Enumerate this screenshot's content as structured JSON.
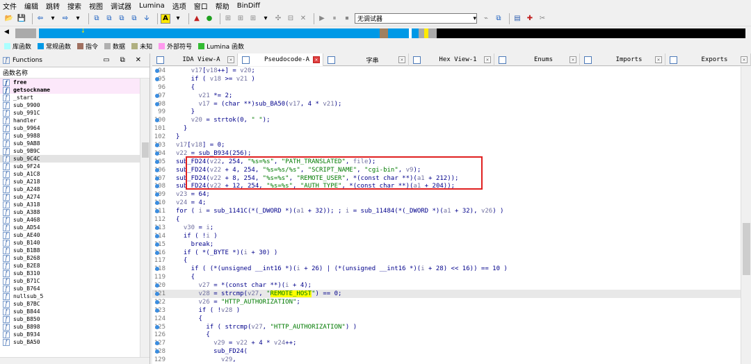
{
  "menu": [
    "文件",
    "编辑",
    "跳转",
    "搜索",
    "视图",
    "调试器",
    "Lumina",
    "选项",
    "窗口",
    "帮助",
    "BinDiff"
  ],
  "toolbar": {
    "debugger_select": "无调试器"
  },
  "legend": [
    {
      "label": "库函数",
      "color": "#aaffff"
    },
    {
      "label": "常规函数",
      "color": "#0099e6"
    },
    {
      "label": "指令",
      "color": "#a07060"
    },
    {
      "label": "数据",
      "color": "#b0b0b0"
    },
    {
      "label": "未知",
      "color": "#b0b080"
    },
    {
      "label": "外部符号",
      "color": "#ff99ee"
    },
    {
      "label": "Lumina 函数",
      "color": "#33bb33"
    }
  ],
  "functions": {
    "title": "Functions",
    "column_header": "函数名称",
    "items": [
      {
        "name": "free",
        "lib": true
      },
      {
        "name": "getsockname",
        "lib": true
      },
      {
        "name": "_start"
      },
      {
        "name": "sub_9900"
      },
      {
        "name": "sub_991C"
      },
      {
        "name": "handler"
      },
      {
        "name": "sub_9964"
      },
      {
        "name": "sub_9988"
      },
      {
        "name": "sub_9AB8"
      },
      {
        "name": "sub_9B9C"
      },
      {
        "name": "sub_9C4C",
        "sel": true
      },
      {
        "name": "sub_9F24"
      },
      {
        "name": "sub_A1C8"
      },
      {
        "name": "sub_A218"
      },
      {
        "name": "sub_A248"
      },
      {
        "name": "sub_A274"
      },
      {
        "name": "sub_A318"
      },
      {
        "name": "sub_A388"
      },
      {
        "name": "sub_A468"
      },
      {
        "name": "sub_AD54"
      },
      {
        "name": "sub_AE40"
      },
      {
        "name": "sub_B140"
      },
      {
        "name": "sub_B1B8"
      },
      {
        "name": "sub_B268"
      },
      {
        "name": "sub_B2E8"
      },
      {
        "name": "sub_B310"
      },
      {
        "name": "sub_B71C"
      },
      {
        "name": "sub_B764"
      },
      {
        "name": "nullsub_5"
      },
      {
        "name": "sub_B7BC"
      },
      {
        "name": "sub_B844"
      },
      {
        "name": "sub_B850"
      },
      {
        "name": "sub_B898"
      },
      {
        "name": "sub_B934"
      },
      {
        "name": "sub_BA50"
      }
    ]
  },
  "tabs": [
    {
      "label": "IDA View-A",
      "active": false
    },
    {
      "label": "Pseudocode-A",
      "active": true
    },
    {
      "label": "字串",
      "active": false
    },
    {
      "label": "Hex View-1",
      "active": false
    },
    {
      "label": "Enums",
      "active": false
    },
    {
      "label": "Imports",
      "active": false
    },
    {
      "label": "Exports",
      "active": false
    }
  ],
  "code": [
    {
      "n": "94",
      "dot": true,
      "t": "    v17[v18++] = v20;"
    },
    {
      "n": "95",
      "dot": true,
      "t": "    if ( v18 >= v21 )"
    },
    {
      "n": "96",
      "t": "    {"
    },
    {
      "n": "97",
      "dot": true,
      "t": "      v21 *= 2;"
    },
    {
      "n": "98",
      "dot": true,
      "t": "      v17 = (char **)sub_BA50(v17, 4 * v21);"
    },
    {
      "n": "99",
      "t": "    }"
    },
    {
      "n": "100",
      "dot": true,
      "t": "    v20 = strtok(0, \" \");"
    },
    {
      "n": "101",
      "t": "  }"
    },
    {
      "n": "102",
      "t": "}"
    },
    {
      "n": "103",
      "dot": true,
      "t": "v17[v18] = 0;"
    },
    {
      "n": "104",
      "dot": true,
      "t": "v22 = sub_B934(256);"
    },
    {
      "n": "105",
      "dot": true,
      "t": "sub_FD24(v22, 254, \"%s=%s\", \"PATH_TRANSLATED\", file);"
    },
    {
      "n": "106",
      "dot": true,
      "t": "sub_FD24(v22 + 4, 254, \"%s=%s/%s\", \"SCRIPT_NAME\", \"cgi-bin\", v9);"
    },
    {
      "n": "107",
      "dot": true,
      "t": "sub_FD24(v22 + 8, 254, \"%s=%s\", \"REMOTE_USER\", *(const char **)(a1 + 212));"
    },
    {
      "n": "108",
      "dot": true,
      "t": "sub_FD24(v22 + 12, 254, \"%s=%s\", \"AUTH_TYPE\", *(const char **)(a1 + 204));"
    },
    {
      "n": "109",
      "dot": true,
      "t": "v23 = 64;"
    },
    {
      "n": "110",
      "dot": true,
      "t": "v24 = 4;"
    },
    {
      "n": "111",
      "dot": true,
      "t": "for ( i = sub_1141C(*(_DWORD *)(a1 + 32)); ; i = sub_11484(*(_DWORD *)(a1 + 32), v26) )"
    },
    {
      "n": "112",
      "t": "{"
    },
    {
      "n": "113",
      "dot": true,
      "t": "  v30 = i;"
    },
    {
      "n": "114",
      "dot": true,
      "t": "  if ( !i )"
    },
    {
      "n": "115",
      "dot": true,
      "t": "    break;"
    },
    {
      "n": "116",
      "dot": true,
      "t": "  if ( *(_BYTE *)(i + 30) )"
    },
    {
      "n": "117",
      "t": "  {"
    },
    {
      "n": "118",
      "dot": true,
      "t": "    if ( (*(unsigned __int16 *)(i + 26) | (*(unsigned __int16 *)(i + 28) << 16)) == 10 )"
    },
    {
      "n": "119",
      "t": "    {"
    },
    {
      "n": "120",
      "dot": true,
      "t": "      v27 = *(const char **)(i + 4);"
    },
    {
      "n": "121",
      "dot": true,
      "t": "      v28 = strcmp(v27, \"REMOTE_HOST\") == 0;",
      "hl": true
    },
    {
      "n": "122",
      "dot": true,
      "t": "      v26 = \"HTTP_AUTHORIZATION\";"
    },
    {
      "n": "123",
      "dot": true,
      "t": "      if ( !v28 )"
    },
    {
      "n": "124",
      "t": "      {"
    },
    {
      "n": "125",
      "dot": true,
      "t": "        if ( strcmp(v27, \"HTTP_AUTHORIZATION\") )"
    },
    {
      "n": "126",
      "t": "        {"
    },
    {
      "n": "127",
      "dot": true,
      "t": "          v29 = v22 + 4 * v24++;"
    },
    {
      "n": "128",
      "dot": true,
      "t": "          sub_FD24("
    },
    {
      "n": "129",
      "t": "            v29,"
    }
  ],
  "highlight_word": "REMOTE_HOST"
}
